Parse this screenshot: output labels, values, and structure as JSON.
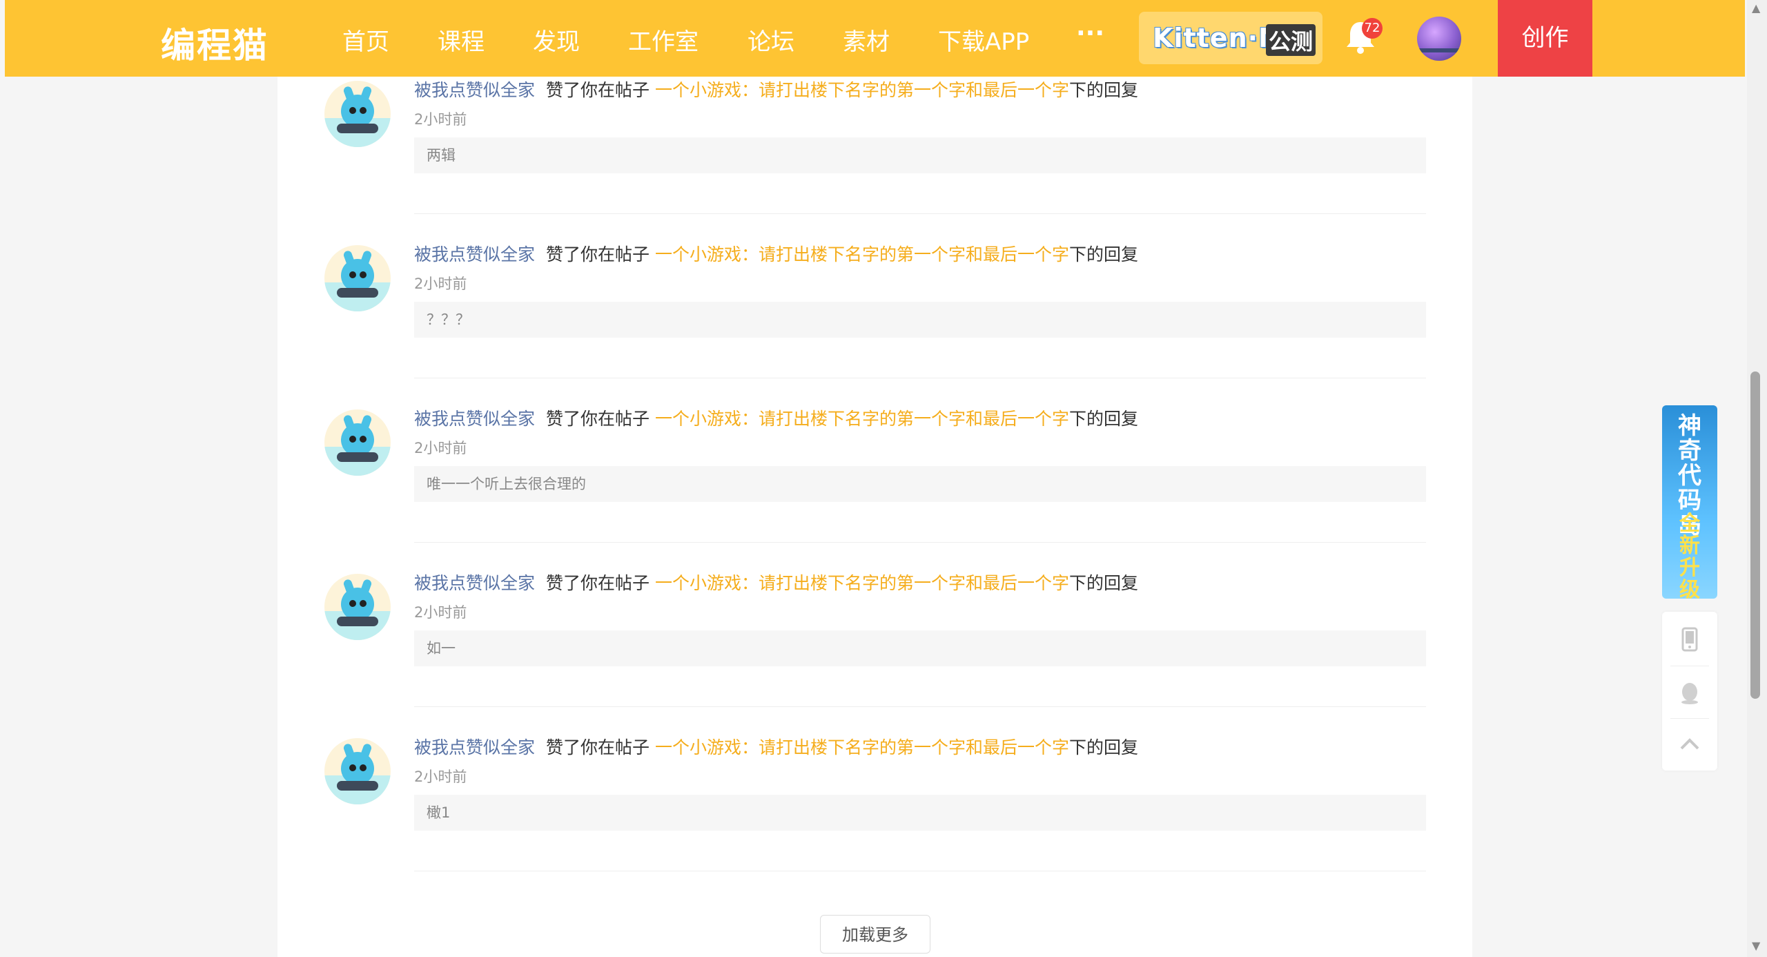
{
  "header": {
    "logo": "编程猫",
    "nav": [
      "首页",
      "课程",
      "发现",
      "工作室",
      "论坛",
      "素材",
      "下载APP"
    ],
    "more": "···",
    "kitten": {
      "name": "Kitten·N",
      "tag": "公测"
    },
    "notification_count": "72",
    "create_label": "创作"
  },
  "notifications": [
    {
      "user": "被我点赞似全家",
      "action": "赞了你在帖子",
      "post": "一个小游戏：请打出楼下名字的第一个字和最后一个字",
      "suffix": "下的回复",
      "time": "2小时前",
      "quote": "两辑"
    },
    {
      "user": "被我点赞似全家",
      "action": "赞了你在帖子",
      "post": "一个小游戏：请打出楼下名字的第一个字和最后一个字",
      "suffix": "下的回复",
      "time": "2小时前",
      "quote": "？？？"
    },
    {
      "user": "被我点赞似全家",
      "action": "赞了你在帖子",
      "post": "一个小游戏：请打出楼下名字的第一个字和最后一个字",
      "suffix": "下的回复",
      "time": "2小时前",
      "quote": "唯一一个听上去很合理的"
    },
    {
      "user": "被我点赞似全家",
      "action": "赞了你在帖子",
      "post": "一个小游戏：请打出楼下名字的第一个字和最后一个字",
      "suffix": "下的回复",
      "time": "2小时前",
      "quote": "如一"
    },
    {
      "user": "被我点赞似全家",
      "action": "赞了你在帖子",
      "post": "一个小游戏：请打出楼下名字的第一个字和最后一个字",
      "suffix": "下的回复",
      "time": "2小时前",
      "quote": "橄1"
    }
  ],
  "load_more": "加载更多",
  "side_banner": {
    "line1": "神奇代码岛",
    "line2": "全新升级"
  },
  "side_tools": [
    "phone-icon",
    "qq-icon",
    "back-to-top-icon"
  ],
  "colors": {
    "header": "#fec433",
    "create": "#ee4245",
    "username": "#5a74a6",
    "post_link": "#f5ad1c"
  }
}
